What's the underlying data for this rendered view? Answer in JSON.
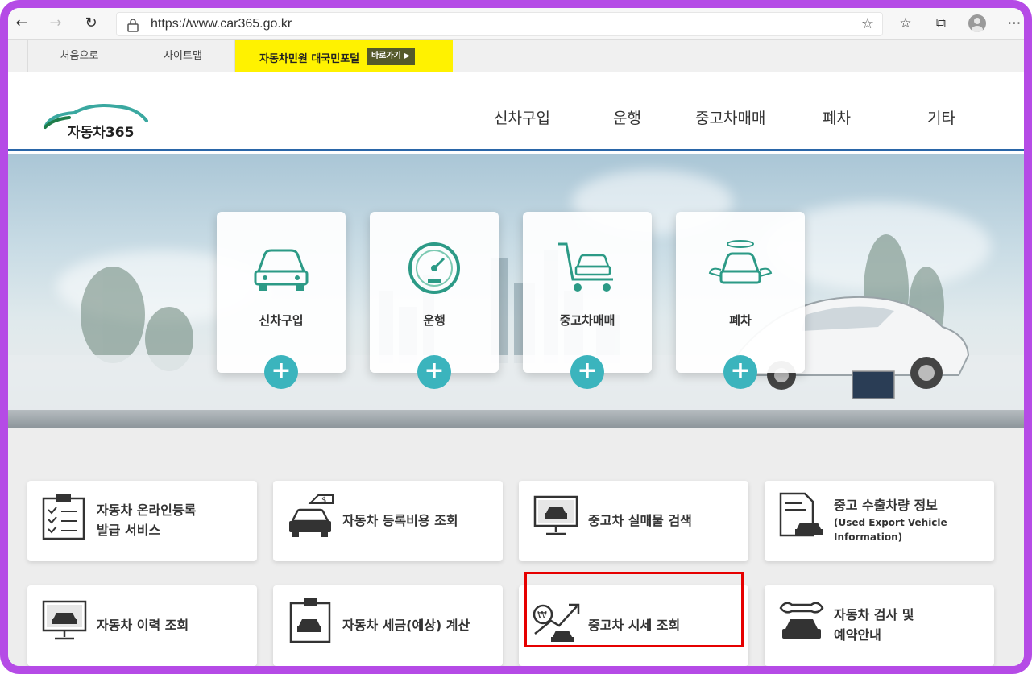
{
  "browser": {
    "url": "https://www.car365.go.kr"
  },
  "util": {
    "home": "처음으로",
    "sitemap": "사이트맵",
    "portal": "자동차민원 대국민포털",
    "go": "바로가기 ▶"
  },
  "header": {
    "logo": "자동차365",
    "nav": [
      "신차구입",
      "운행",
      "중고차매매",
      "폐차",
      "기타"
    ]
  },
  "hero_cards": [
    {
      "label": "신차구입"
    },
    {
      "label": "운행"
    },
    {
      "label": "중고차매매"
    },
    {
      "label": "폐차"
    }
  ],
  "services": [
    {
      "line1": "자동차 온라인등록",
      "line2": "발급 서비스"
    },
    {
      "line1": "자동차 등록비용 조회"
    },
    {
      "line1": "중고차 실매물 검색"
    },
    {
      "line1": "중고 수출차량 정보",
      "sub1": "(Used Export Vehicle",
      "sub2": "Information)"
    },
    {
      "line1": "자동차 이력 조회"
    },
    {
      "line1": "자동차 세금(예상) 계산"
    },
    {
      "line1": "중고차 시세 조회"
    },
    {
      "line1": "자동차 검사 및",
      "line2": "예약안내"
    }
  ],
  "colors": {
    "frame": "#b54be6",
    "accent_teal": "#3bb4bd",
    "portal_yellow": "#fff200",
    "header_line": "#2a66a8",
    "highlight": "#e60000"
  }
}
